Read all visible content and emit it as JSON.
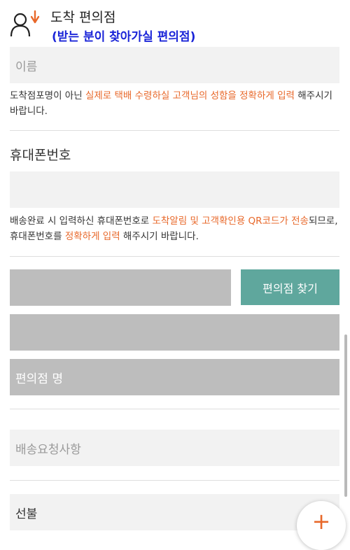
{
  "header": {
    "title": "도착 편의점",
    "subtitle": "(받는 분이 찾아가실 편의점)",
    "icon": "person-arrow-down-icon",
    "accent_color": "#e8682a",
    "subtitle_color": "#1a24d8"
  },
  "name_field": {
    "placeholder": "이름"
  },
  "name_note": {
    "part1": "도착점포명이 아닌 ",
    "highlight1": "실제로 택배 수령하실 고객님의 성함을 정확하게 입력",
    "part2": " 해주시기 바랍니다."
  },
  "phone_section": {
    "label": "휴대폰번호",
    "value": ""
  },
  "phone_note": {
    "part1": "배송완료 시 입력하신 휴대폰번호로 ",
    "highlight1": "도착알림 및 고객확인용 QR코드가 전송",
    "part2": "되므로, 휴대폰번호를 ",
    "highlight2": "정확하게 입력",
    "part3": " 해주시기 바랍니다."
  },
  "store_search": {
    "button_label": "편의점 찾기",
    "button_color": "#5fa79d",
    "search_value": "",
    "address_value": "",
    "store_name_placeholder": "편의점 명"
  },
  "delivery_request": {
    "placeholder": "배송요청사항"
  },
  "payment": {
    "value": "선불"
  },
  "fab": {
    "icon": "plus-icon"
  }
}
